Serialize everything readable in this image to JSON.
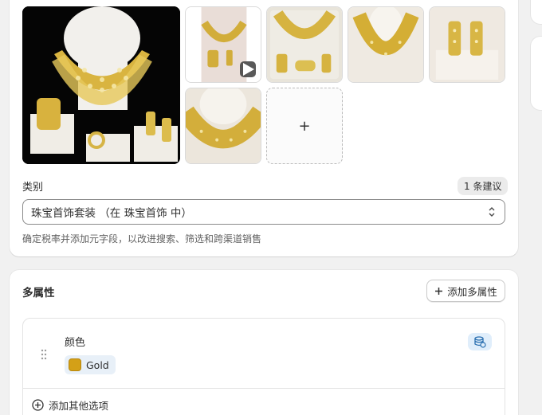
{
  "media": {
    "add_label": "+",
    "images": [
      {
        "name": "jewelry-set-main",
        "alt": "gold necklace set"
      },
      {
        "name": "jewelry-video",
        "alt": "video thumbnail"
      },
      {
        "name": "jewelry-set-box",
        "alt": "set in box"
      },
      {
        "name": "necklace-closeup",
        "alt": "necklace"
      },
      {
        "name": "earrings",
        "alt": "earrings"
      },
      {
        "name": "necklace-detail",
        "alt": "necklace detail"
      }
    ]
  },
  "category": {
    "label": "类别",
    "suggestion_badge": "1 条建议",
    "selected": "珠宝首饰套装 （在 珠宝首饰 中）",
    "help_text": "确定税率并添加元字段，以改进搜索、筛选和跨渠道销售"
  },
  "variants": {
    "heading": "多属性",
    "add_button": "添加多属性",
    "option": {
      "name": "颜色",
      "values": [
        {
          "label": "Gold",
          "color": "#d4a017"
        }
      ]
    },
    "add_other_option": "添加其他选项"
  },
  "colors": {
    "background": "#f1f1f1",
    "card": "#ffffff",
    "gold": "#d4a017",
    "accent_blue": "#e0eefb"
  }
}
